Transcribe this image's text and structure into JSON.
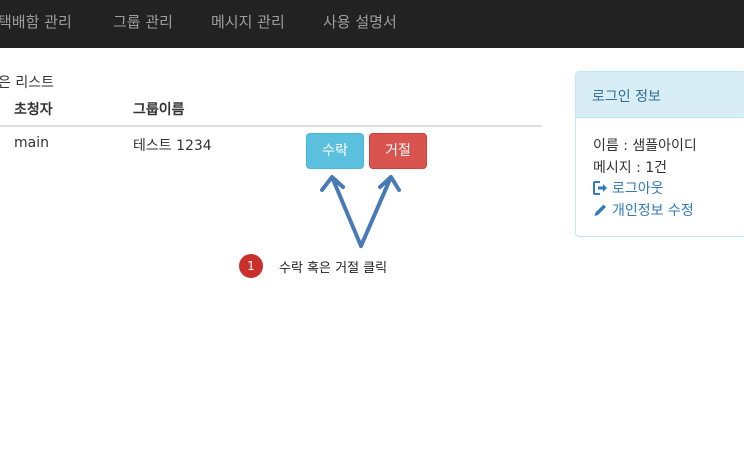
{
  "navbar": {
    "items": [
      "택배함 관리",
      "그룹 관리",
      "메시지 관리",
      "사용 설명서"
    ]
  },
  "invite_list": {
    "title": "은 리스트",
    "columns": [
      "초청자",
      "그룹이름"
    ],
    "rows": [
      {
        "inviter": "main",
        "group_name": "테스트 1234"
      }
    ],
    "accept_label": "수락",
    "reject_label": "거절"
  },
  "guide": {
    "step_number": "1",
    "step_text": "수락 혹은 거절 클릭"
  },
  "login_panel": {
    "title": "로그인 정보",
    "name_line": "이름 : 샘플아이디",
    "message_line": "메시지 : 1건",
    "logout_label": "로그아웃",
    "edit_profile_label": "개인정보 수정"
  },
  "colors": {
    "navbar_bg": "#222222",
    "accept": "#5bc0de",
    "reject": "#d9534f",
    "arrow": "#4a7ab5",
    "badge": "#c9302c",
    "panel_heading": "#d9edf7",
    "link": "#337ab7"
  }
}
